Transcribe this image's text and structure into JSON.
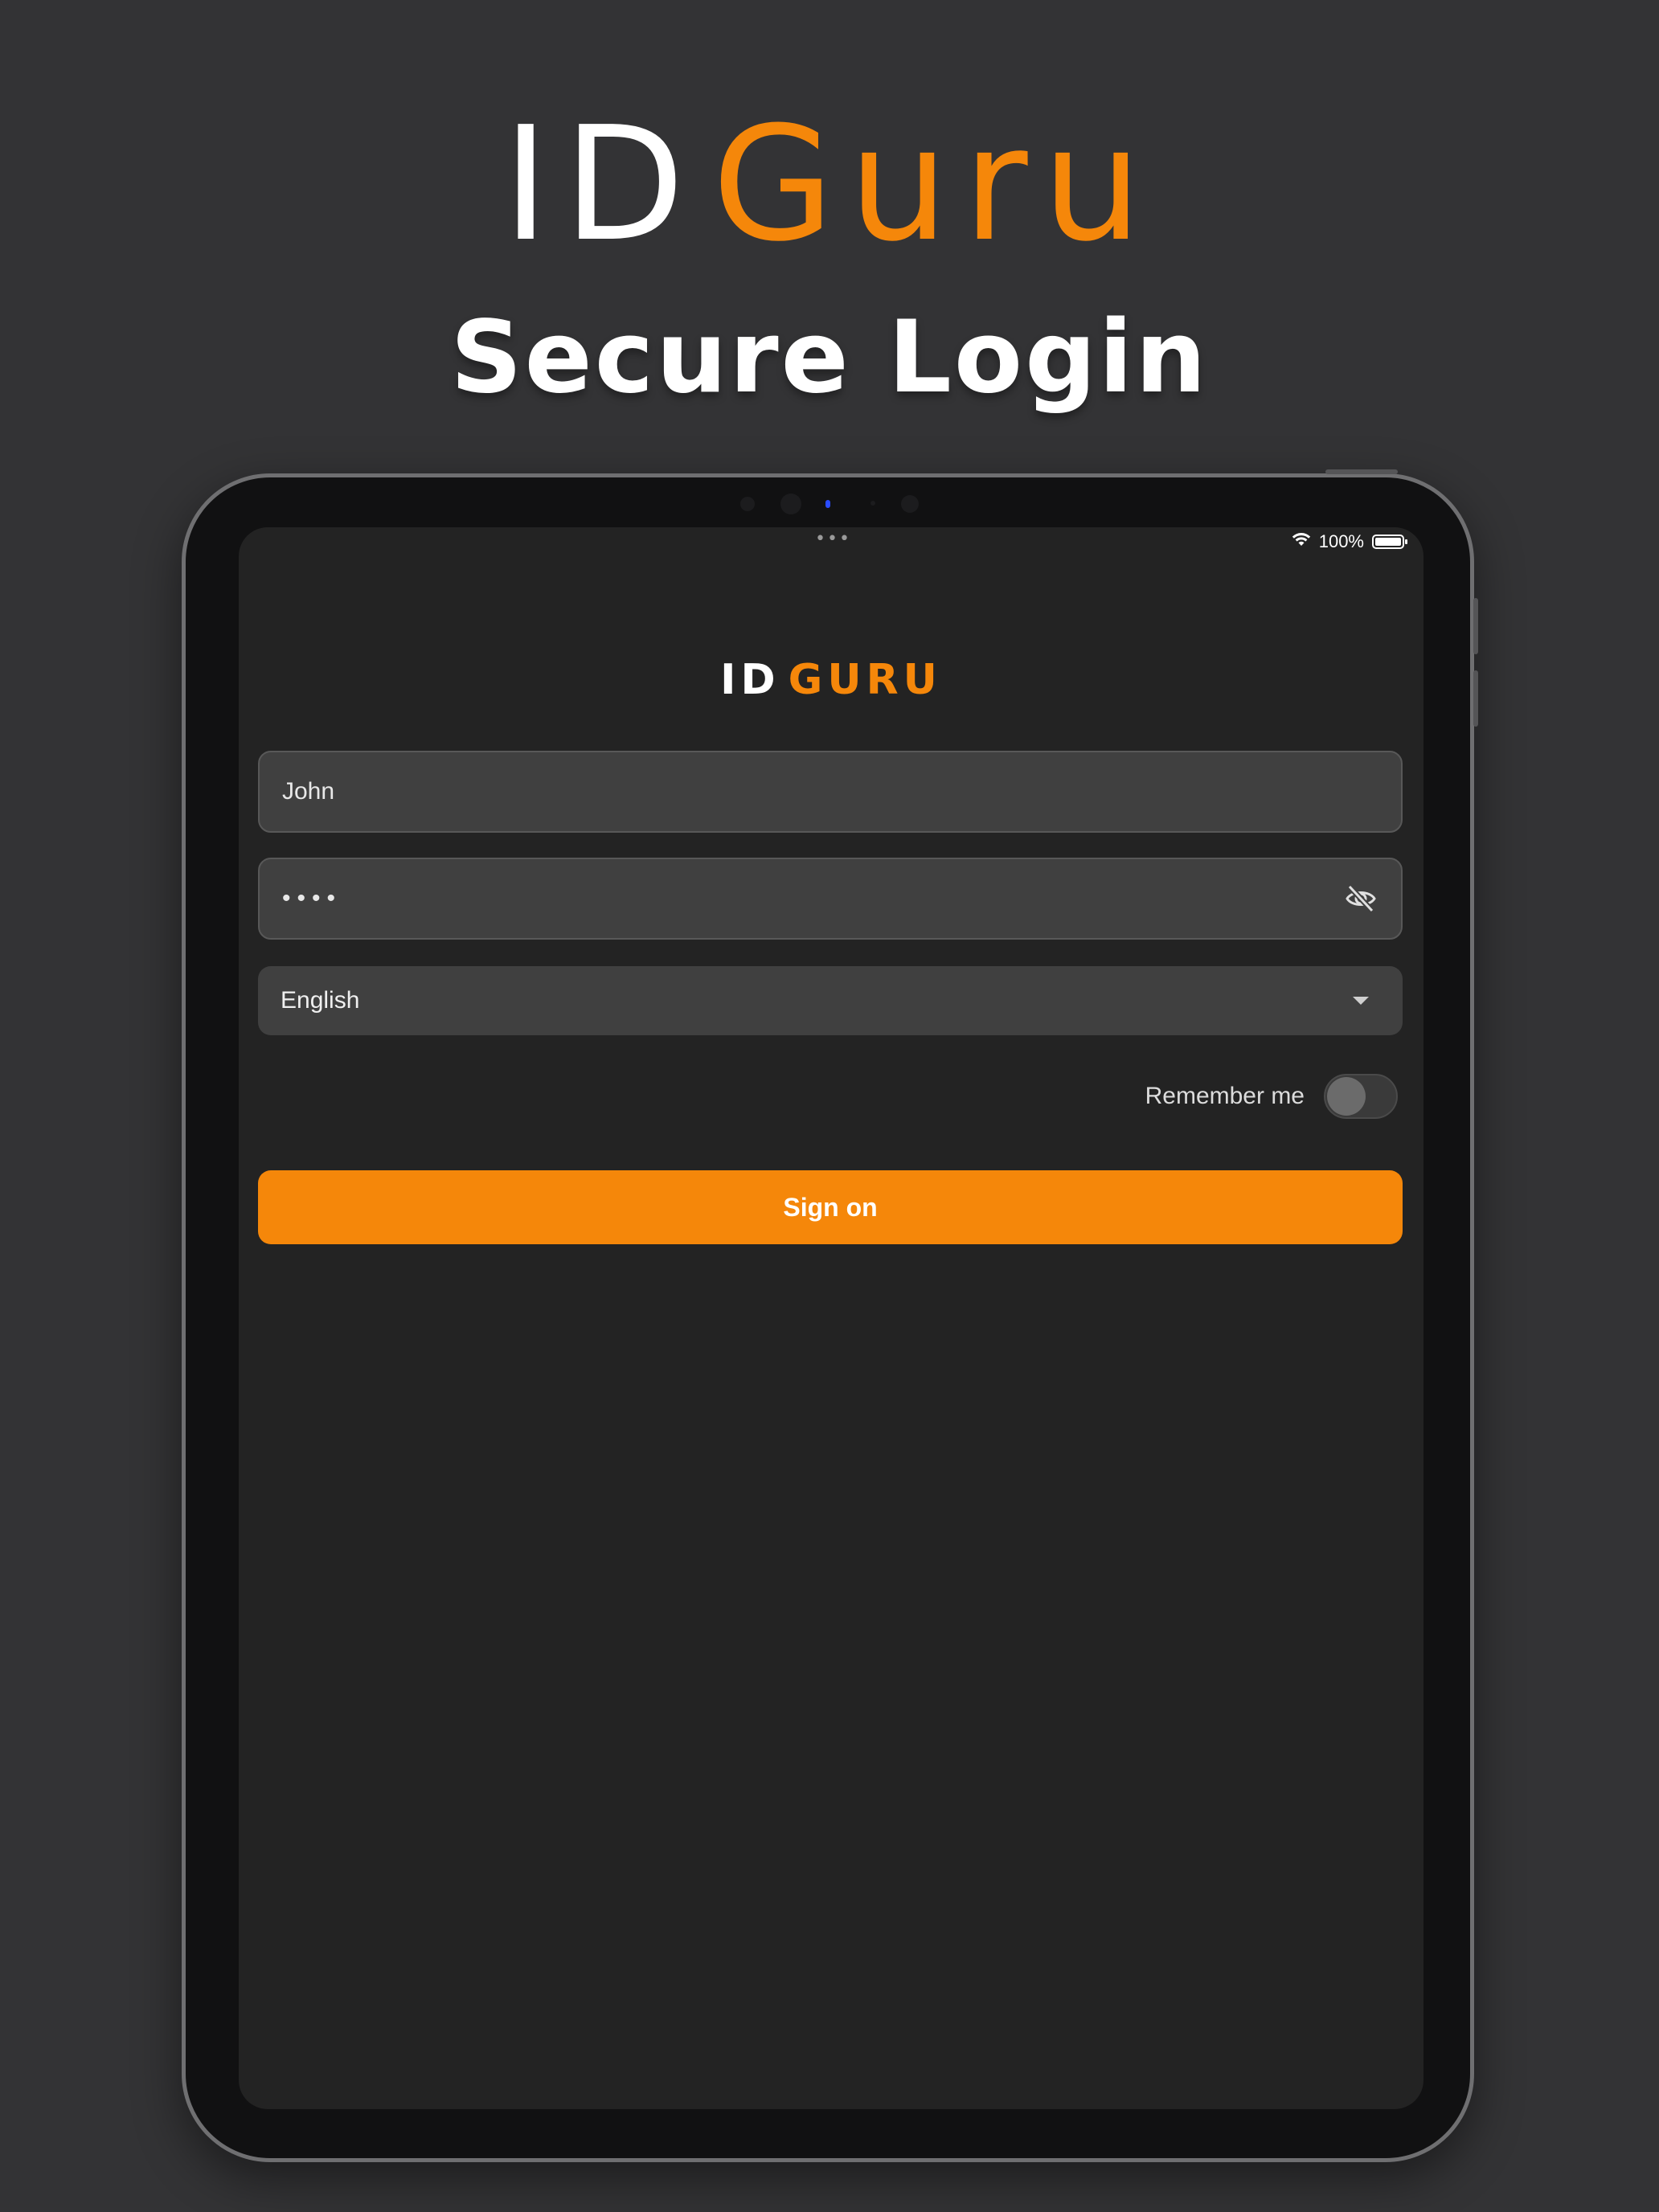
{
  "hero": {
    "logo_part1": "ID",
    "logo_part2": "Guru",
    "title": "Secure Login"
  },
  "status_bar": {
    "dots": "•••",
    "battery_percent": "100%"
  },
  "app_logo": {
    "part1": "ID",
    "part2": "GURU"
  },
  "login_form": {
    "username_value": "John",
    "password_value": "••••",
    "language_selected": "English",
    "remember_label": "Remember me",
    "remember_on": false,
    "sign_on_label": "Sign on"
  },
  "colors": {
    "accent": "#f5870a",
    "background": "#333335",
    "screen": "#232323",
    "field": "#404040"
  },
  "icons": [
    "wifi-icon",
    "battery-icon",
    "eye-off-icon",
    "caret-down-icon"
  ]
}
